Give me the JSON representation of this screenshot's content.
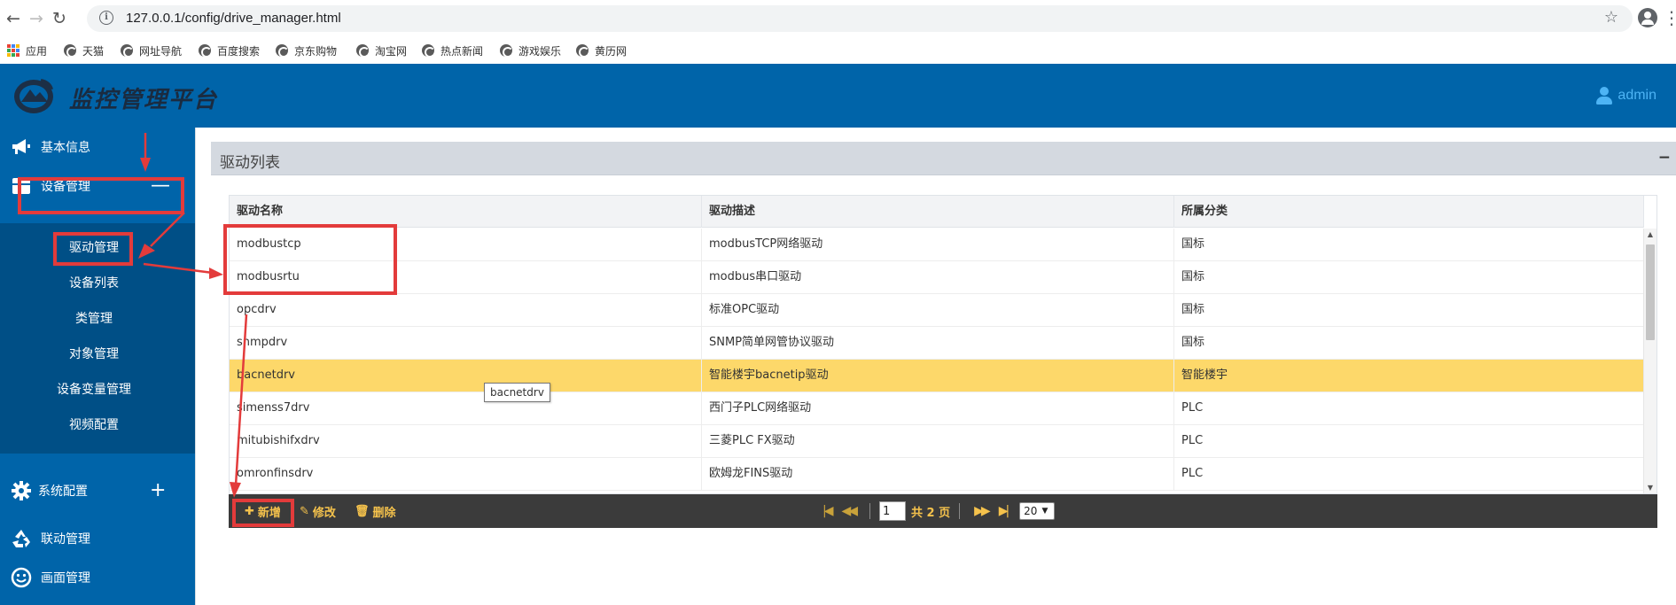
{
  "browser": {
    "url": "127.0.0.1/config/drive_manager.html",
    "bookmarks": [
      {
        "label": "应用"
      },
      {
        "label": "天猫"
      },
      {
        "label": "网址导航"
      },
      {
        "label": "百度搜索"
      },
      {
        "label": "京东购物"
      },
      {
        "label": "淘宝网"
      },
      {
        "label": "热点新闻"
      },
      {
        "label": "游戏娱乐"
      },
      {
        "label": "黄历网"
      }
    ]
  },
  "header": {
    "title": "监控管理平台",
    "user": "admin",
    "bg_color": "#0064a9",
    "user_color": "#4db4f5"
  },
  "sidebar": {
    "items": [
      {
        "label": "基本信息",
        "icon": "megaphone-icon"
      },
      {
        "label": "设备管理",
        "icon": "grid-icon",
        "toggle": "—"
      },
      {
        "label": "系统配置",
        "icon": "gear-icon",
        "toggle": "+"
      },
      {
        "label": "联动管理",
        "icon": "recycle-icon"
      },
      {
        "label": "画面管理",
        "icon": "smiley-icon"
      }
    ],
    "submenu": [
      {
        "label": "驱动管理"
      },
      {
        "label": "设备列表"
      },
      {
        "label": "类管理"
      },
      {
        "label": "对象管理"
      },
      {
        "label": "设备变量管理"
      },
      {
        "label": "视频配置"
      }
    ]
  },
  "panel": {
    "title": "驱动列表",
    "collapse": "−"
  },
  "table": {
    "columns": [
      "驱动名称",
      "驱动描述",
      "所属分类"
    ],
    "rows": [
      {
        "name": "modbustcp",
        "desc": "modbusTCP网络驱动",
        "category": "国标"
      },
      {
        "name": "modbusrtu",
        "desc": "modbus串口驱动",
        "category": "国标"
      },
      {
        "name": "opcdrv",
        "desc": "标准OPC驱动",
        "category": "国标"
      },
      {
        "name": "snmpdrv",
        "desc": "SNMP简单网管协议驱动",
        "category": "国标"
      },
      {
        "name": "bacnetdrv",
        "desc": "智能楼宇bacnetip驱动",
        "category": "智能楼宇",
        "selected": true
      },
      {
        "name": "simenss7drv",
        "desc": "西门子PLC网络驱动",
        "category": "PLC"
      },
      {
        "name": "mitubishifxdrv",
        "desc": "三菱PLC FX驱动",
        "category": "PLC"
      },
      {
        "name": "omronfinsdrv",
        "desc": "欧姆龙FINS驱动",
        "category": "PLC"
      }
    ],
    "selected_color": "#fdd86a",
    "tooltip": "bacnetdrv"
  },
  "toolbar": {
    "add": "新增",
    "edit": "修改",
    "delete": "删除",
    "page": "1",
    "total": "共 2 页",
    "page_size": "20",
    "accent": "#f5c24c"
  },
  "annotation_color": "#e33b3b"
}
